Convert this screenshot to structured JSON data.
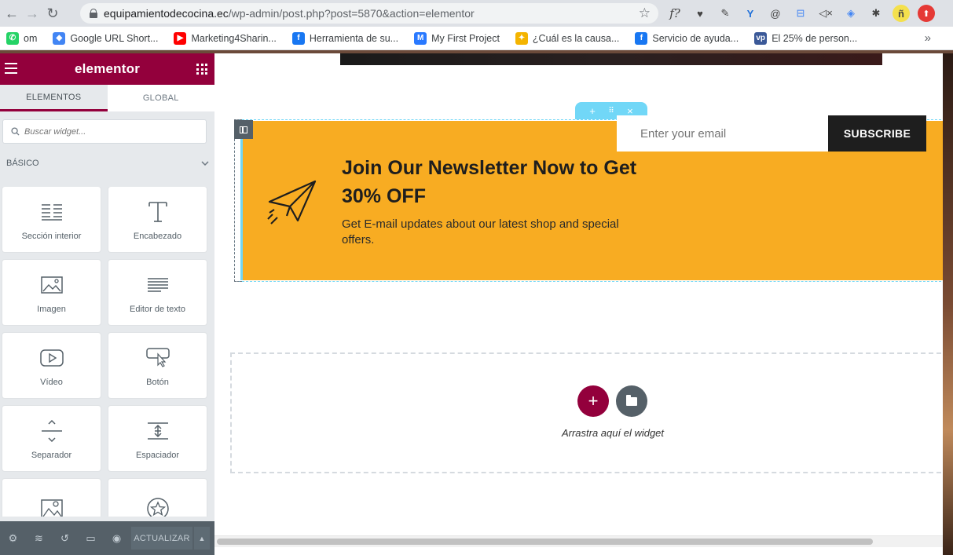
{
  "browser": {
    "url_host": "equipamientodecocina.ec",
    "url_path": "/wp-admin/post.php?post=5870&action=elementor",
    "extensions": [
      "f?",
      "♥",
      "✎",
      "Y",
      "@",
      "⊟",
      "🔇",
      "◈",
      "✱",
      "ñ",
      "⬆"
    ]
  },
  "bookmarks": [
    {
      "label": "om",
      "icon_color": "#25d366",
      "glyph": "✆"
    },
    {
      "label": "Google URL Short...",
      "icon_color": "#4285f4",
      "glyph": "◆"
    },
    {
      "label": "Marketing4Sharin...",
      "icon_color": "#ff0000",
      "glyph": "▶"
    },
    {
      "label": "Herramienta de su...",
      "icon_color": "#1877f2",
      "glyph": "f"
    },
    {
      "label": "My First Project",
      "icon_color": "#2979ff",
      "glyph": "M"
    },
    {
      "label": "¿Cuál es la causa...",
      "icon_color": "#f4b400",
      "glyph": "✦"
    },
    {
      "label": "Servicio de ayuda...",
      "icon_color": "#1877f2",
      "glyph": "f"
    },
    {
      "label": "El 25% de person...",
      "icon_color": "#3b5998",
      "glyph": "vp"
    }
  ],
  "panel": {
    "brand": "elementor",
    "tabs": [
      "ELEMENTOS",
      "GLOBAL"
    ],
    "search_placeholder": "Buscar widget...",
    "category": "BÁSICO",
    "widgets": [
      {
        "label": "Sección interior",
        "icon": "inner-section-icon"
      },
      {
        "label": "Encabezado",
        "icon": "heading-icon"
      },
      {
        "label": "Imagen",
        "icon": "image-icon"
      },
      {
        "label": "Editor de texto",
        "icon": "text-editor-icon"
      },
      {
        "label": "Vídeo",
        "icon": "video-icon"
      },
      {
        "label": "Botón",
        "icon": "button-icon"
      },
      {
        "label": "Separador",
        "icon": "divider-icon"
      },
      {
        "label": "Espaciador",
        "icon": "spacer-icon"
      },
      {
        "label": "",
        "icon": "map-icon"
      },
      {
        "label": "",
        "icon": "star-icon"
      }
    ],
    "footer": {
      "update_label": "ACTUALIZAR"
    },
    "accent": "#93003c"
  },
  "newsletter": {
    "title": "Join Our Newsletter Now to Get 30% OFF",
    "subtitle": "Get E-mail updates about our latest shop and special offers.",
    "email_placeholder": "Enter your email",
    "button_label": "SUBSCRIBE",
    "background": "#f8ac22"
  },
  "dropzone": {
    "text": "Arrastra aquí el widget"
  }
}
